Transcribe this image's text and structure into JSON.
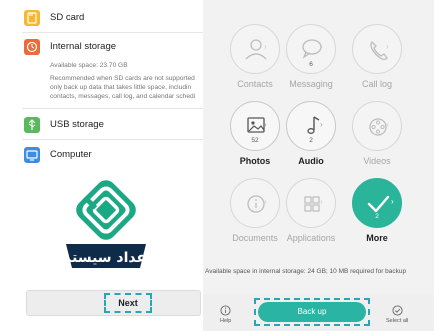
{
  "left": {
    "sd_card": {
      "label": "SD card",
      "icon": "sd-card-icon",
      "color": "#f5b82e"
    },
    "internal": {
      "label": "Internal storage",
      "icon": "internal-storage-icon",
      "color": "#ef6a3a",
      "available": "Available space: 23.70 GB",
      "note_lines": [
        "Recommended when SD cards are not supported",
        "only back up data that takes little space, includin",
        "contacts, messages, call log, and calendar schedi"
      ]
    },
    "usb": {
      "label": "USB storage",
      "icon": "usb-icon",
      "color": "#5cb85c"
    },
    "computer": {
      "label": "Computer",
      "icon": "computer-icon",
      "color": "#3a8ee6"
    },
    "logo_text": "اعداد سیستم",
    "next_label": "Next"
  },
  "right": {
    "items": [
      {
        "key": "contacts",
        "label": "Contacts",
        "icon": "contacts-icon",
        "count": ""
      },
      {
        "key": "messaging",
        "label": "Messaging",
        "icon": "messaging-icon",
        "count": "6"
      },
      {
        "key": "calllog",
        "label": "Call log",
        "icon": "call-log-icon",
        "count": ""
      },
      {
        "key": "photos",
        "label": "Photos",
        "icon": "photos-icon",
        "count": "52"
      },
      {
        "key": "audio",
        "label": "Audio",
        "icon": "audio-icon",
        "count": "2"
      },
      {
        "key": "videos",
        "label": "Videos",
        "icon": "videos-icon",
        "count": ""
      },
      {
        "key": "documents",
        "label": "Documents",
        "icon": "documents-icon",
        "count": ""
      },
      {
        "key": "applications",
        "label": "Applications",
        "icon": "applications-icon",
        "count": ""
      },
      {
        "key": "more",
        "label": "More",
        "icon": "checkmark-icon",
        "count": "2"
      }
    ],
    "available_text": "Available space in internal storage: 24 GB; 10 MB required for backup",
    "help_label": "Help",
    "backup_label": "Back up",
    "select_all_label": "Select all",
    "accent": "#29b4a4"
  }
}
